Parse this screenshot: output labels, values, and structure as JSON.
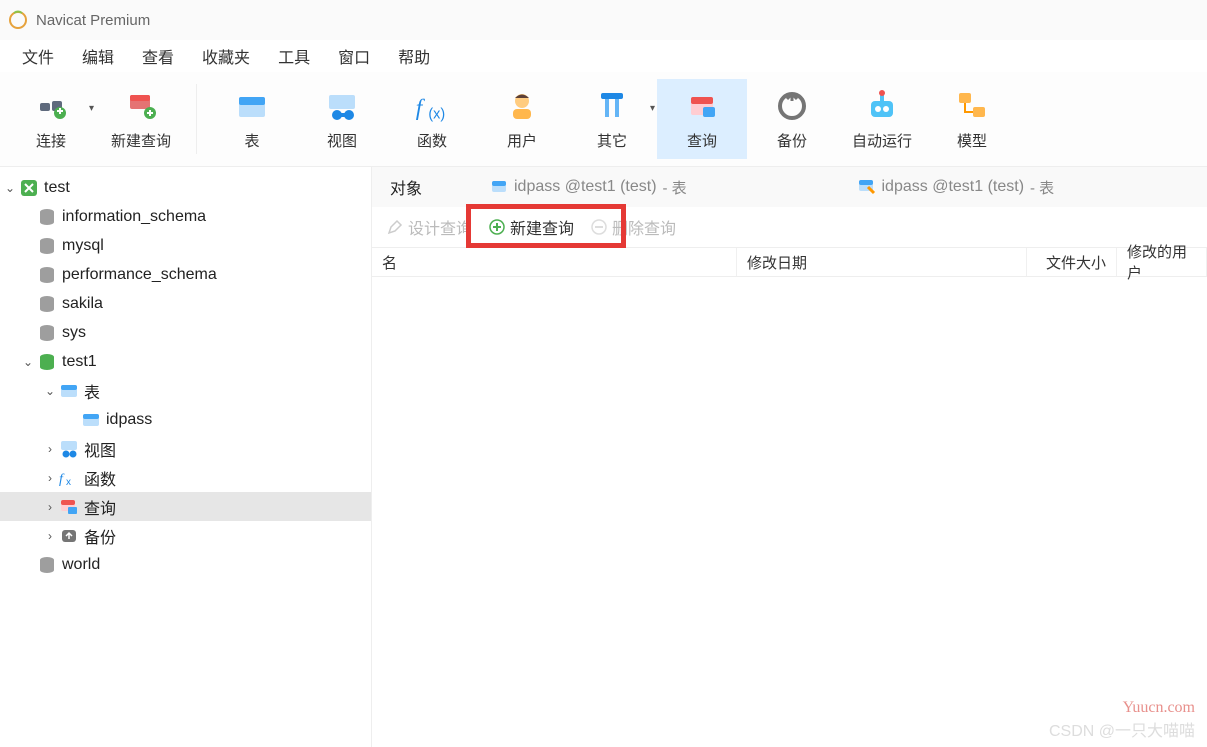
{
  "title": "Navicat Premium",
  "menu": [
    "文件",
    "编辑",
    "查看",
    "收藏夹",
    "工具",
    "窗口",
    "帮助"
  ],
  "toolbar": [
    {
      "label": "连接",
      "icon": "plug"
    },
    {
      "label": "新建查询",
      "icon": "newquery"
    },
    {
      "sep": true
    },
    {
      "label": "表",
      "icon": "table"
    },
    {
      "label": "视图",
      "icon": "view"
    },
    {
      "label": "函数",
      "icon": "fx"
    },
    {
      "label": "用户",
      "icon": "user"
    },
    {
      "label": "其它",
      "icon": "other"
    },
    {
      "label": "查询",
      "icon": "query",
      "selected": true
    },
    {
      "label": "备份",
      "icon": "backup"
    },
    {
      "label": "自动运行",
      "icon": "robot"
    },
    {
      "label": "模型",
      "icon": "model"
    }
  ],
  "tree": {
    "conn": "test",
    "dbs": [
      {
        "name": "information_schema",
        "open": false
      },
      {
        "name": "mysql",
        "open": false
      },
      {
        "name": "performance_schema",
        "open": false
      },
      {
        "name": "sakila",
        "open": false
      },
      {
        "name": "sys",
        "open": false
      },
      {
        "name": "test1",
        "open": true,
        "children": [
          {
            "name": "表",
            "icon": "table",
            "open": true,
            "children": [
              {
                "name": "idpass",
                "icon": "table-item"
              }
            ]
          },
          {
            "name": "视图",
            "icon": "view-s",
            "collapsed": true
          },
          {
            "name": "函数",
            "icon": "fx-s",
            "collapsed": true
          },
          {
            "name": "查询",
            "icon": "query-s",
            "selected": true,
            "collapsed": true
          },
          {
            "name": "备份",
            "icon": "backup-s",
            "collapsed": true
          }
        ]
      },
      {
        "name": "world",
        "open": false
      }
    ]
  },
  "tabs": {
    "objects": "对象",
    "t1": {
      "name": "idpass @test1 (test)",
      "suffix": "- 表"
    },
    "t2": {
      "name": "idpass @test1 (test)",
      "suffix": "- 表"
    }
  },
  "actions": {
    "design": "设计查询",
    "new": "新建查询",
    "delete": "删除查询"
  },
  "columns": {
    "name": "名",
    "modified": "修改日期",
    "filesize": "文件大小",
    "moduser": "修改的用户"
  },
  "watermarks": {
    "w1": "Yuucn.com",
    "w2": "CSDN @一只大喵喵"
  }
}
